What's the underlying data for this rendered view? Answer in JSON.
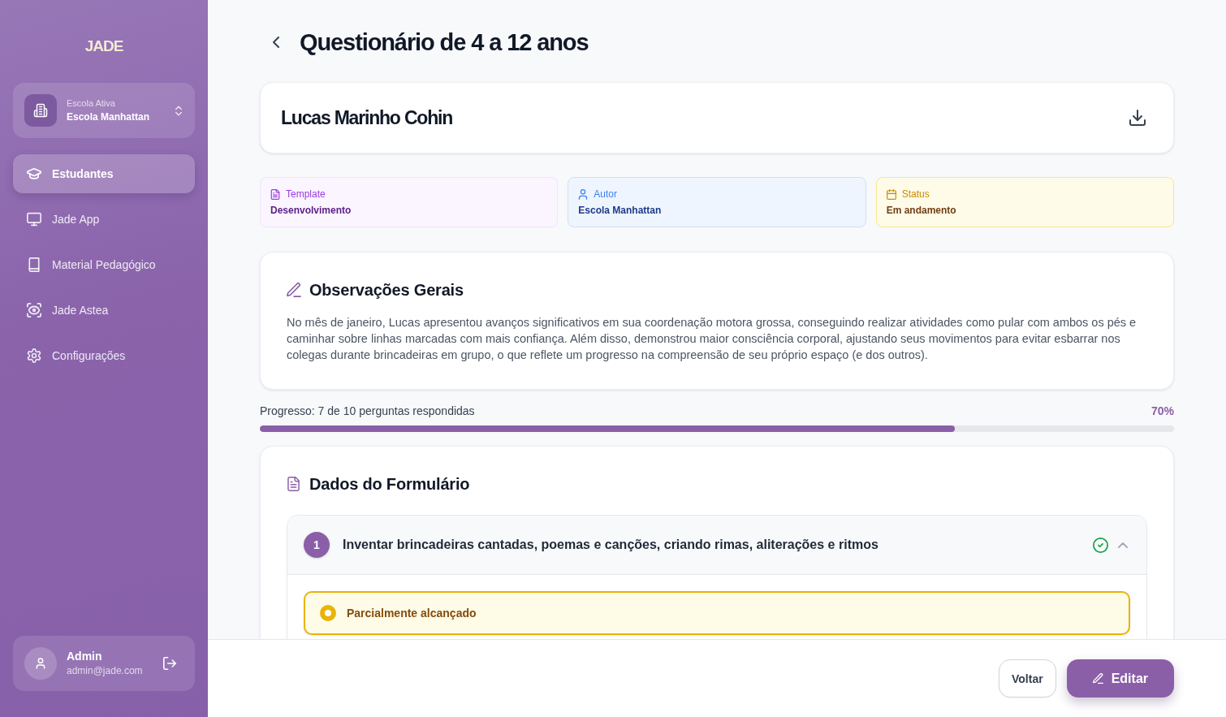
{
  "sidebar": {
    "logo": "JADE",
    "school_selector": {
      "label": "Escola Ativa",
      "value": "Escola Manhattan"
    },
    "nav": [
      {
        "label": "Estudantes",
        "selected": true
      },
      {
        "label": "Jade App",
        "selected": false
      },
      {
        "label": "Material Pedagógico",
        "selected": false
      },
      {
        "label": "Jade Astea",
        "selected": false
      },
      {
        "label": "Configurações",
        "selected": false
      }
    ],
    "user": {
      "name": "Admin",
      "email": "admin@jade.com"
    }
  },
  "header": {
    "title": "Questionário de 4 a 12 anos"
  },
  "student": {
    "name": "Lucas Marinho Cohin"
  },
  "info_cards": [
    {
      "kind": "template",
      "label": "Template",
      "value": "Desenvolvimento"
    },
    {
      "kind": "author",
      "label": "Autor",
      "value": "Escola Manhattan"
    },
    {
      "kind": "status",
      "label": "Status",
      "value": "Em andamento"
    }
  ],
  "observations": {
    "title": "Observações Gerais",
    "text": "No mês de janeiro, Lucas apresentou avanços significativos em sua coordenação motora grossa, conseguindo realizar atividades como pular com ambos os pés e caminhar sobre linhas marcadas com mais confiança. Além disso, demonstrou maior consciência corporal, ajustando seus movimentos para evitar esbarrar nos colegas durante brincadeiras em grupo, o que reflete um progresso na compreensão de seu próprio espaço (e dos outros)."
  },
  "progress": {
    "label": "Progresso: 7 de 10 perguntas respondidas",
    "percent": "70%",
    "level": 0.76
  },
  "form": {
    "title": "Dados do Formulário",
    "questions": [
      {
        "number": "1",
        "text": "Inventar brincadeiras cantadas, poemas e canções, criando rimas, aliterações e ritmos",
        "answered": true,
        "expanded": true,
        "options": [
          {
            "label": "Parcialmente alcançado",
            "selected": true
          }
        ]
      }
    ]
  },
  "footer": {
    "buttons": [
      {
        "kind": "secondary",
        "label": "Voltar"
      },
      {
        "kind": "primary",
        "label": "Editar"
      }
    ]
  }
}
